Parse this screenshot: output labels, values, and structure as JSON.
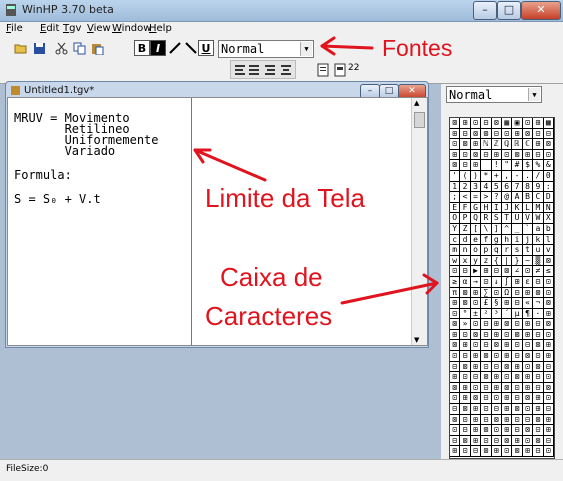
{
  "window": {
    "title": "WinHP 3.70 beta",
    "minimize": "–",
    "maximize": "□",
    "close": "✕"
  },
  "menu": [
    "File",
    "Edit",
    "Tgv",
    "View",
    "Window",
    "Help"
  ],
  "toolbar": {
    "bold": "B",
    "italic": "I",
    "underline": "U",
    "font_value": "Normal",
    "size_value": "22"
  },
  "document": {
    "title": "Untitled1.tgv*",
    "lines": [
      "MRUV = Movimento",
      "       Retilineo",
      "       Uniformemente",
      "       Variado",
      "",
      "Formula:",
      "",
      "S = S₀ + V.t"
    ]
  },
  "charbox": {
    "font_value": "Normal",
    "chars": [
      "⊠",
      "⊞",
      "⊡",
      "⊟",
      "⊠",
      "▦",
      "▣",
      "⊡",
      "⊞",
      "▩",
      "⊞",
      "⊟",
      "⊠",
      "⊠",
      "⊟",
      "⊡",
      "⊞",
      "⊠",
      "⊡",
      "⊟",
      "⊡",
      "⊠",
      "⊞",
      "ℕ",
      "ℤ",
      "ℚ",
      "ℝ",
      "ℂ",
      "⊞",
      "⊠",
      "⊞",
      "⊡",
      "⊠",
      "⊟",
      "⊞",
      "⊡",
      "⊠",
      "⊞",
      "⊟",
      "⊡",
      "⊠",
      "⊟",
      "⊞",
      " ",
      "!",
      "\"",
      "#",
      "$",
      "%",
      "&",
      "'",
      "(",
      ")",
      "*",
      "+",
      ",",
      "-",
      ".",
      "/",
      "0",
      "1",
      "2",
      "3",
      "4",
      "5",
      "6",
      "7",
      "8",
      "9",
      ":",
      ";",
      "<",
      "=",
      ">",
      "?",
      "@",
      "A",
      "B",
      "C",
      "D",
      "E",
      "F",
      "G",
      "H",
      "I",
      "J",
      "K",
      "L",
      "M",
      "N",
      "O",
      "P",
      "Q",
      "R",
      "S",
      "T",
      "U",
      "V",
      "W",
      "X",
      "Y",
      "Z",
      "[",
      "\\",
      "]",
      "^",
      "_",
      "`",
      "a",
      "b",
      "c",
      "d",
      "e",
      "f",
      "g",
      "h",
      "i",
      "j",
      "k",
      "l",
      "m",
      "n",
      "o",
      "p",
      "q",
      "r",
      "s",
      "t",
      "u",
      "v",
      "w",
      "x",
      "y",
      "z",
      "{",
      "|",
      "}",
      "~",
      "▒",
      "⊠",
      "⊡",
      "⊟",
      "▶",
      "⊞",
      "⊟",
      "⊠",
      "∠",
      "⊡",
      "≠",
      "≤",
      "≥",
      "α",
      "→",
      "⊡",
      "↓",
      "∫",
      "⊞",
      "ε",
      "⊟",
      "⊡",
      "π",
      "⊠",
      "⊞",
      "∑",
      "⊡",
      "Ω",
      "⊟",
      "⊞",
      "⊠",
      "⊡",
      "⊞",
      "⊠",
      "⊡",
      "£",
      "§",
      "⊞",
      "⊟",
      "«",
      "¬",
      "⊠",
      "⊡",
      "°",
      "±",
      "²",
      "³",
      "´",
      "µ",
      "¶",
      "·",
      "⊞",
      "⊠",
      "»",
      "⊡",
      "⊟",
      "⊞",
      "⊠",
      "⊡",
      "⊞",
      "⊟",
      "⊠",
      "⊞",
      "⊡",
      "⊠",
      "⊟",
      "⊞",
      "⊡",
      "⊠",
      "⊞",
      "⊟",
      "⊡",
      "⊠",
      "⊞",
      "⊡",
      "⊟",
      "⊠",
      "⊞",
      "⊡",
      "⊟",
      "⊠",
      "⊞",
      "⊡",
      "⊟",
      "⊞",
      "⊠",
      "⊡",
      "⊞",
      "⊟",
      "⊠",
      "⊡",
      "⊞",
      "⊟",
      "⊠",
      "⊞",
      "⊡",
      "⊟",
      "⊠",
      "⊞",
      "⊡",
      "⊠",
      "⊟",
      "⊞",
      "⊡",
      "⊟",
      "⊠",
      "⊞",
      "⊡",
      "⊠",
      "⊞",
      "⊟",
      "⊡",
      "⊠",
      "⊞",
      "⊡",
      "⊟",
      "⊞",
      "⊠",
      "⊡",
      "⊞",
      "⊟",
      "⊠",
      "⊡",
      "⊞",
      "⊠",
      "⊟",
      "⊡",
      "⊞",
      "⊟",
      "⊠",
      "⊞",
      "⊡",
      "⊟",
      "⊠",
      "⊞",
      "⊡",
      "⊟",
      "⊞",
      "⊠",
      "⊡",
      "⊞",
      "⊟",
      "⊠",
      "⊡",
      "⊞",
      "⊟",
      "⊠",
      "⊞",
      "⊡",
      "⊟",
      "⊠",
      "⊞",
      "⊡",
      "⊟",
      "⊞",
      "⊠",
      "⊡",
      "⊞",
      "⊟",
      "⊠",
      "⊡",
      "⊞",
      "⊟",
      "⊠",
      "⊞",
      "⊡",
      "⊟",
      "⊠",
      "⊞",
      "⊡",
      "⊠",
      "⊟",
      "⊞",
      "⊡",
      "⊟",
      "⊠",
      "⊞",
      "⊡",
      "⊠",
      "⊞",
      "⊟",
      "⊡"
    ]
  },
  "annotations": {
    "fonts": "Fontes",
    "screen_limit": "Limite da Tela",
    "charbox_line1": "Caixa de",
    "charbox_line2": "Caracteres",
    "color": "#e0141e"
  },
  "status": {
    "text": "FileSize:0"
  }
}
